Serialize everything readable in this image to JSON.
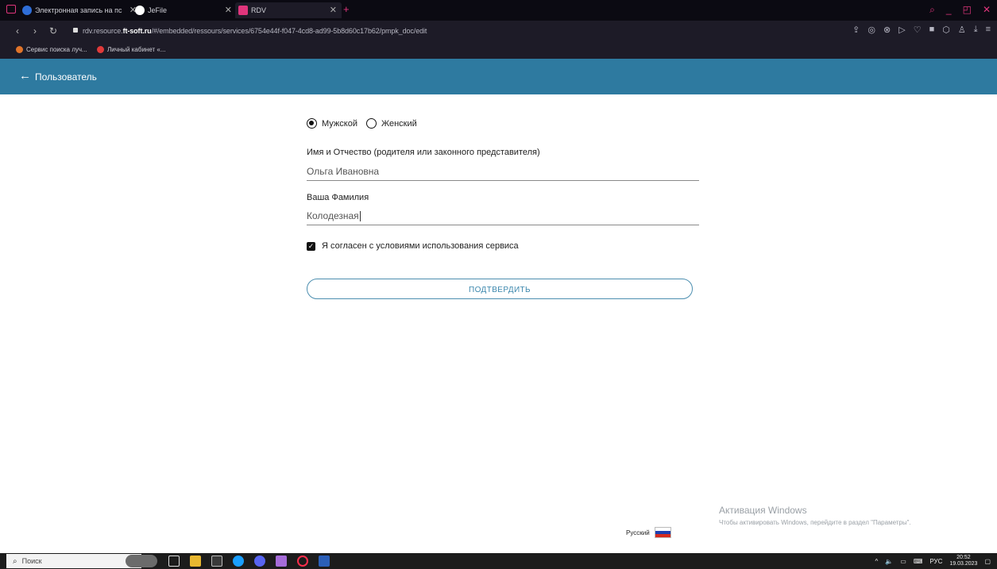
{
  "browser": {
    "tabs": [
      {
        "title": "Электронная запись на пс",
        "fav_color": "#2f6ed8"
      },
      {
        "title": "JeFile",
        "fav_color": "#ffffff"
      },
      {
        "title": "RDV",
        "fav_color": "#e0357c"
      }
    ],
    "url_prefix": "rdv.resource.",
    "url_host": "ft-soft.ru",
    "url_path": "/#/embedded/ressours/services/6754e44f-f047-4cd8-ad99-5b8d60c17b62/pmpk_doc/edit",
    "bookmarks": [
      {
        "label": "Сервис поиска луч...",
        "color": "#e0742a"
      },
      {
        "label": "Личный кабинет «...",
        "color": "#e03a3a"
      }
    ]
  },
  "header": {
    "title": "Пользователь"
  },
  "form": {
    "gender_male": "Мужской",
    "gender_female": "Женский",
    "selected_gender": "male",
    "name_label": "Имя и Отчество (родителя или законного представителя)",
    "name_value": "Ольга Ивановна",
    "surname_label": "Ваша Фамилия",
    "surname_value": "Колодезная",
    "agree_label": "Я согласен с условиями использования сервиса",
    "agree_checked": true,
    "submit_label": "ПОДТВЕРДИТЬ"
  },
  "language": {
    "label": "Русский"
  },
  "watermark": {
    "line1": "Активация Windows",
    "line2": "Чтобы активировать Windows, перейдите в раздел \"Параметры\"."
  },
  "taskbar": {
    "search_placeholder": "Поиск",
    "lang_indicator": "РУС",
    "time": "20:52",
    "date": "19.03.2023"
  },
  "colors": {
    "header_bg": "#2e7aa0",
    "accent": "#3b87ad"
  }
}
